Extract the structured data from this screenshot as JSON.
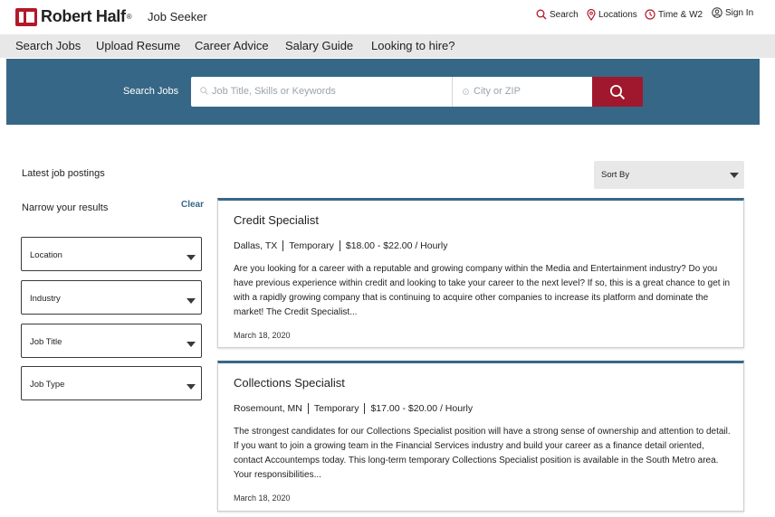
{
  "header": {
    "logo_text": "Robert Half",
    "logo_reg": "®",
    "section": "Job Seeker",
    "utility": [
      {
        "label": "Search",
        "icon": "search-icon"
      },
      {
        "label": "Locations",
        "icon": "location-pin-icon"
      },
      {
        "label": "Time & W2",
        "icon": "clock-icon"
      },
      {
        "label": "Sign In",
        "icon": "user-icon"
      }
    ]
  },
  "nav": {
    "items": [
      "Search Jobs",
      "Upload Resume",
      "Career Advice",
      "Salary Guide",
      "Looking to hire?"
    ]
  },
  "search": {
    "label": "Search Jobs",
    "keyword_placeholder": "Job Title, Skills or Keywords",
    "location_placeholder": "City or ZIP",
    "accent": "#a0182d",
    "band_color": "#376786"
  },
  "sidebar": {
    "latest": "Latest job postings",
    "narrow": "Narrow your results",
    "clear": "Clear",
    "filters": [
      "Location",
      "Industry",
      "Job Title",
      "Job Type"
    ]
  },
  "sort": {
    "label": "Sort By"
  },
  "jobs": [
    {
      "title": "Credit Specialist",
      "location": "Dallas, TX",
      "type": "Temporary",
      "pay": "$18.00 - $22.00 / Hourly",
      "description": "Are you looking for a career with a reputable and growing company within the Media and Entertainment industry? Do you have previous experience within credit and looking to take your career to the next level? If so, this is a great chance to get in with a rapidly growing company that is continuing to acquire other companies to increase its platform and dominate the market! The Credit Specialist...",
      "date": "March 18, 2020"
    },
    {
      "title": "Collections Specialist",
      "location": "Rosemount, MN",
      "type": "Temporary",
      "pay": "$17.00 - $20.00 / Hourly",
      "description": "The strongest candidates for our Collections Specialist position will have a strong sense of ownership and attention to detail. If you want to join a growing team in the Financial Services industry and build your career as a finance detail oriented, contact Accountemps today. This long-term temporary Collections Specialist position is available in the South Metro area. Your responsibilities...",
      "date": "March 18, 2020"
    }
  ]
}
